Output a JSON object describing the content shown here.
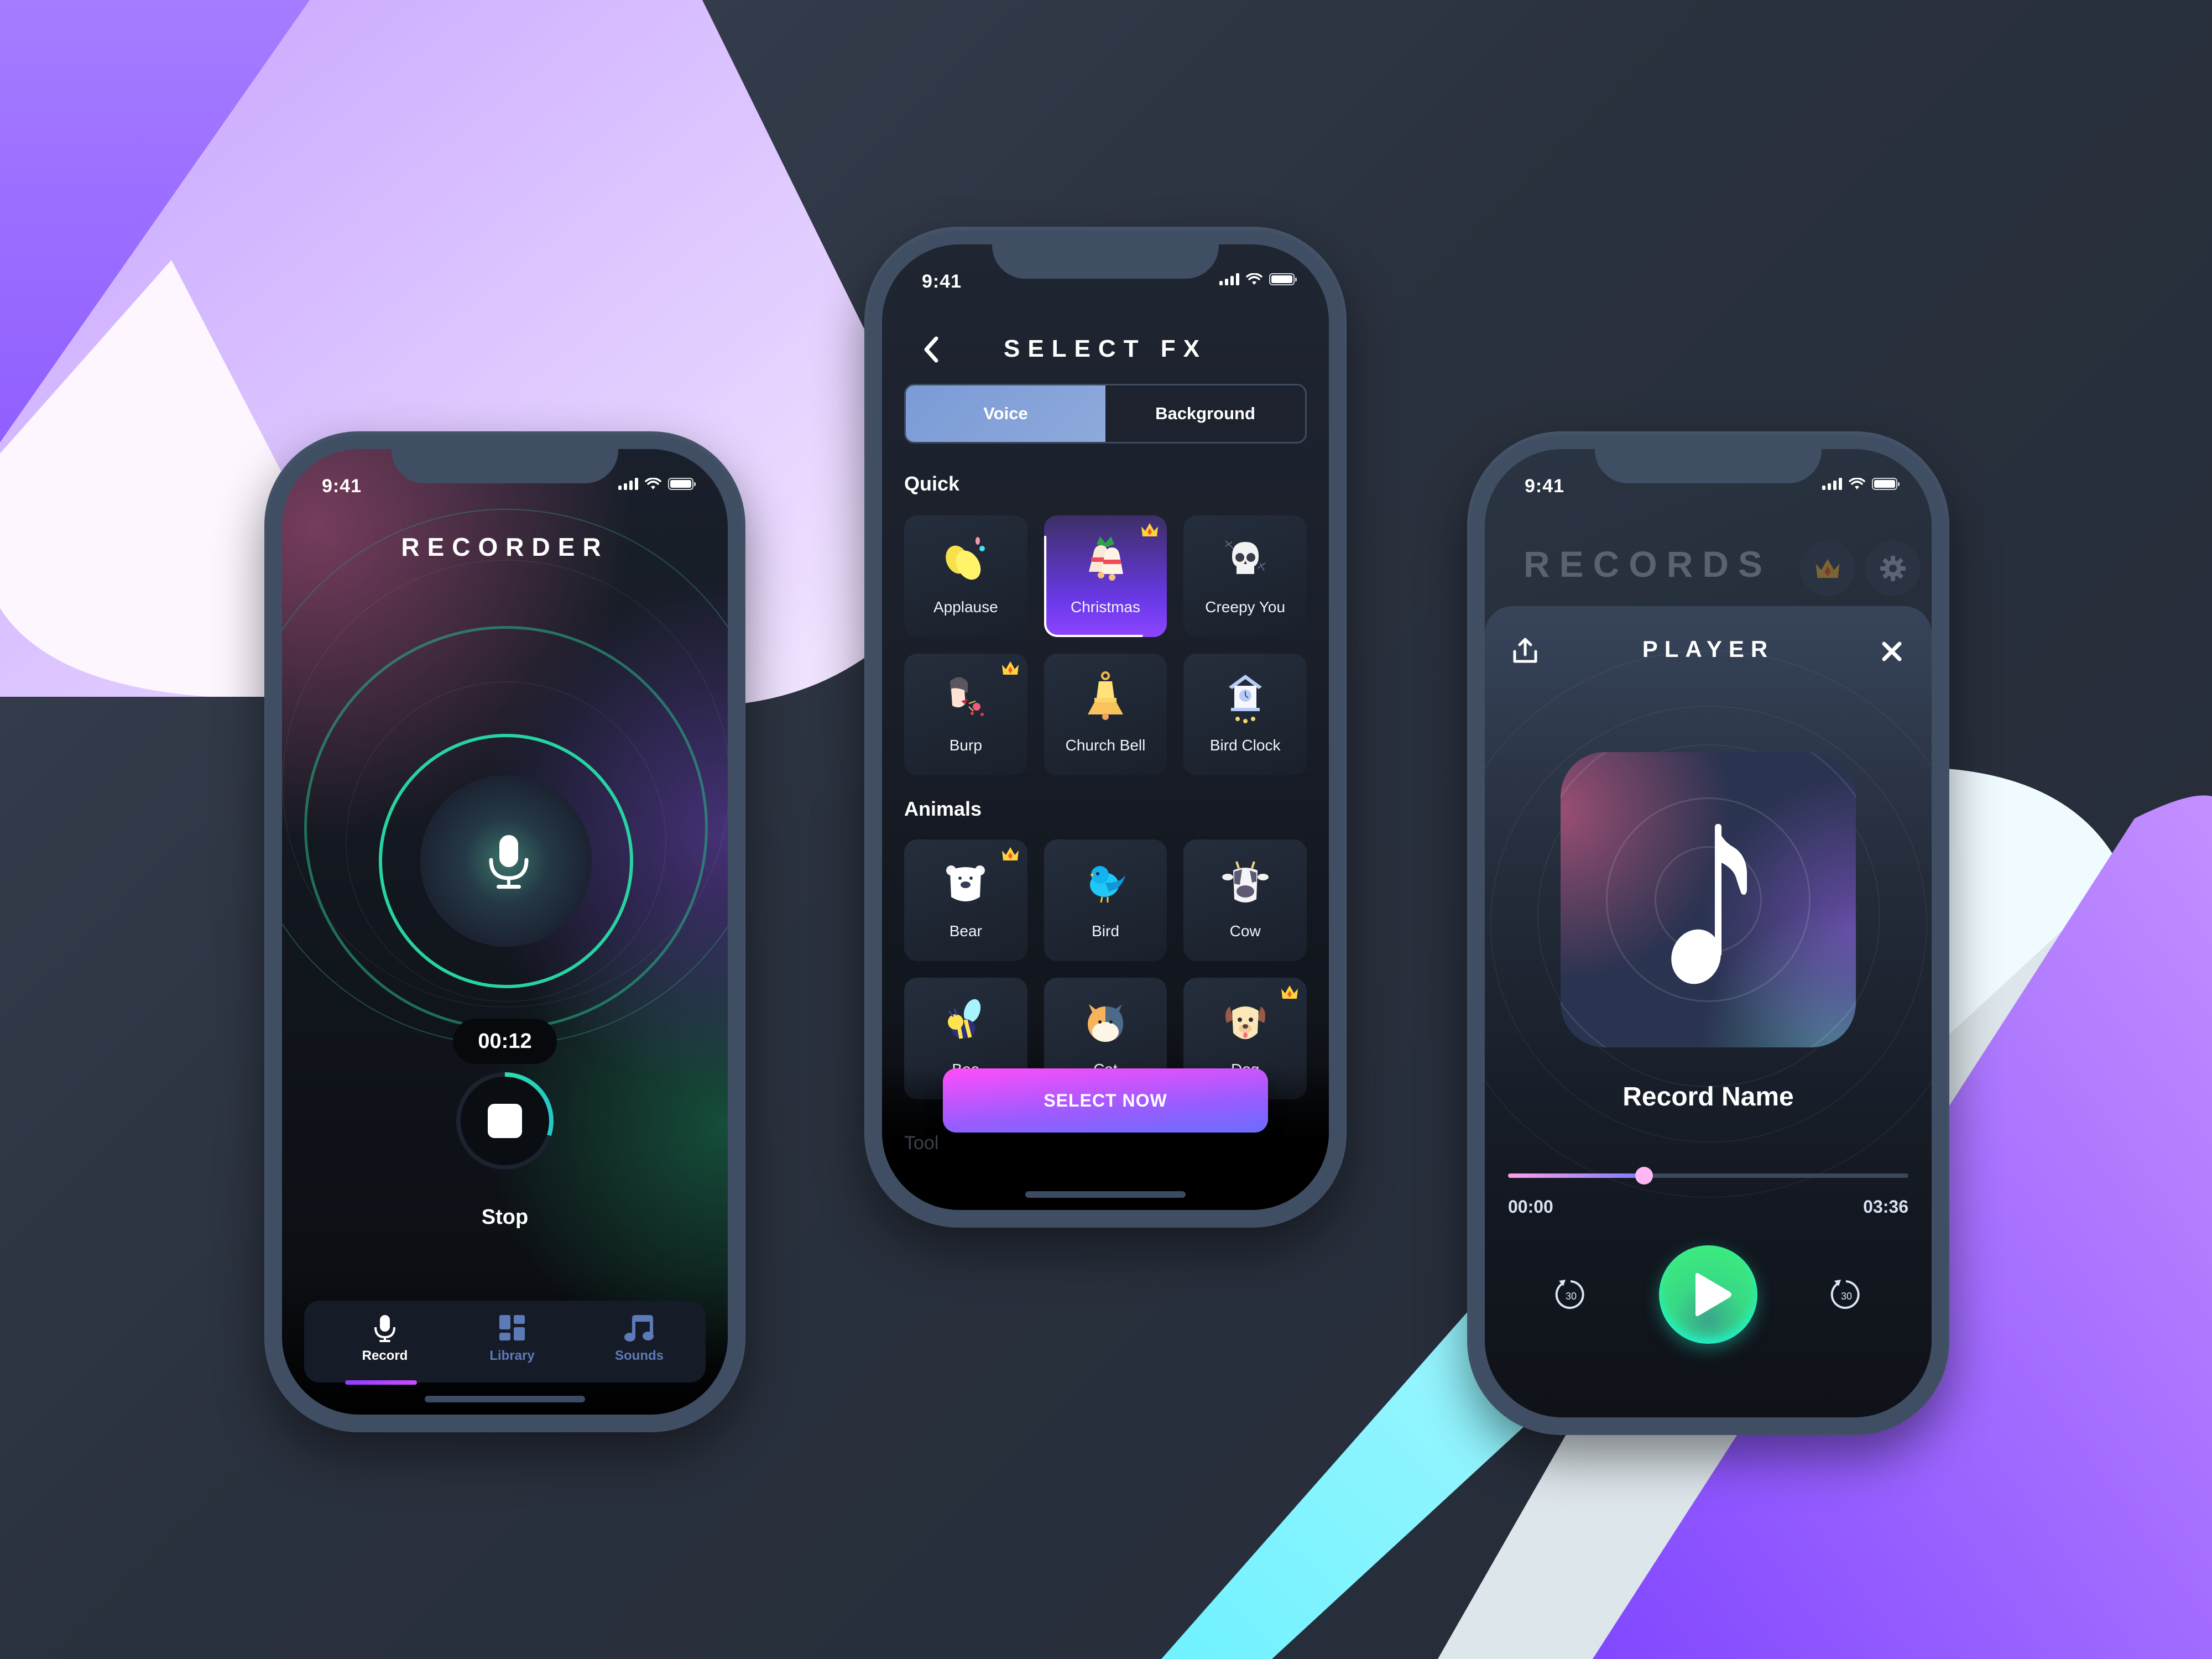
{
  "colors": {
    "accent_green": "#2fe39a",
    "accent_purple": "#8b45ff",
    "accent_pink": "#ff4dfa",
    "segment_active": "#86a3d9",
    "tab_inactive": "#5d7ab8",
    "slider_knob": "#ffb6f5"
  },
  "recorder": {
    "status_time": "9:41",
    "title": "RECORDER",
    "timer": "00:12",
    "stop_progress": 0.3,
    "stop_label": "Stop",
    "tabs": [
      {
        "label": "Record",
        "icon": "microphone-icon",
        "active": true
      },
      {
        "label": "Library",
        "icon": "grid-icon",
        "active": false
      },
      {
        "label": "Sounds",
        "icon": "music-note-icon",
        "active": false
      }
    ]
  },
  "select_fx": {
    "status_time": "9:41",
    "title": "SELECT FX",
    "segments": [
      {
        "label": "Voice",
        "active": true
      },
      {
        "label": "Background",
        "active": false
      }
    ],
    "sections": [
      {
        "title": "Quick",
        "items": [
          {
            "label": "Applause",
            "icon": "clapping-hands-icon",
            "premium": false,
            "selected": false
          },
          {
            "label": "Christmas",
            "icon": "christmas-bells-icon",
            "premium": true,
            "selected": true,
            "progress": 0.4
          },
          {
            "label": "Creepy You",
            "icon": "skull-icon",
            "premium": false,
            "selected": false
          },
          {
            "label": "Burp",
            "icon": "burp-person-icon",
            "premium": true,
            "selected": false
          },
          {
            "label": "Church Bell",
            "icon": "church-bell-icon",
            "premium": false,
            "selected": false
          },
          {
            "label": "Bird Clock",
            "icon": "cuckoo-clock-icon",
            "premium": false,
            "selected": false
          }
        ]
      },
      {
        "title": "Animals",
        "items": [
          {
            "label": "Bear",
            "icon": "polar-bear-icon",
            "premium": true,
            "selected": false
          },
          {
            "label": "Bird",
            "icon": "bird-icon",
            "premium": false,
            "selected": false
          },
          {
            "label": "Cow",
            "icon": "cow-icon",
            "premium": false,
            "selected": false
          },
          {
            "label": "Bee",
            "icon": "bee-icon",
            "premium": false,
            "selected": false
          },
          {
            "label": "Cat",
            "icon": "cat-icon",
            "premium": false,
            "selected": false
          },
          {
            "label": "Dog",
            "icon": "dog-icon",
            "premium": true,
            "selected": false
          }
        ]
      }
    ],
    "next_section_title": "Tool",
    "select_button": "SELECT NOW"
  },
  "player": {
    "status_time": "9:41",
    "background_title": "RECORDS",
    "title": "PLAYER",
    "record_name": "Record Name",
    "time_current": "00:00",
    "time_total": "03:36",
    "progress": 0.34,
    "skip_back_label": "30",
    "skip_forward_label": "30"
  }
}
